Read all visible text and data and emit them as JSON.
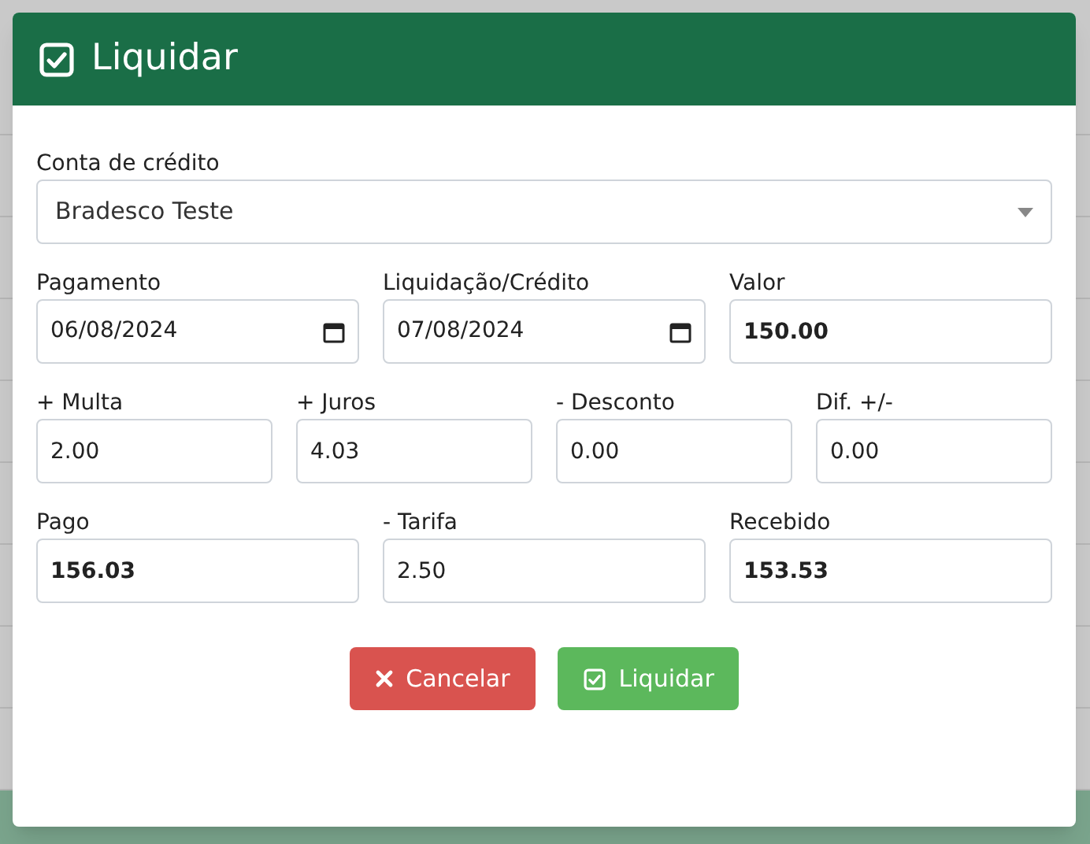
{
  "dialog": {
    "title": "Liquidar",
    "account": {
      "label": "Conta de crédito",
      "value": "Bradesco Teste"
    },
    "rows": [
      [
        {
          "label": "Pagamento",
          "value": "06/08/2024",
          "kind": "date",
          "emphasis": false
        },
        {
          "label": "Liquidação/Crédito",
          "value": "07/08/2024",
          "kind": "date",
          "emphasis": false
        },
        {
          "label": "Valor",
          "value": "150.00",
          "kind": "text",
          "emphasis": true
        }
      ],
      [
        {
          "label": "+ Multa",
          "value": "2.00",
          "kind": "text",
          "emphasis": false
        },
        {
          "label": "+ Juros",
          "value": "4.03",
          "kind": "text",
          "emphasis": false
        },
        {
          "label": "- Desconto",
          "value": "0.00",
          "kind": "text",
          "emphasis": false
        },
        {
          "label": "Dif. +/-",
          "value": "0.00",
          "kind": "text",
          "emphasis": false
        }
      ],
      [
        {
          "label": "Pago",
          "value": "156.03",
          "kind": "text",
          "emphasis": true
        },
        {
          "label": "- Tarifa",
          "value": "2.50",
          "kind": "text",
          "emphasis": false
        },
        {
          "label": "Recebido",
          "value": "153.53",
          "kind": "text",
          "emphasis": true
        }
      ]
    ],
    "buttons": [
      {
        "label": "Cancelar",
        "kind": "cancel"
      },
      {
        "label": "Liquidar",
        "kind": "confirm"
      }
    ]
  }
}
